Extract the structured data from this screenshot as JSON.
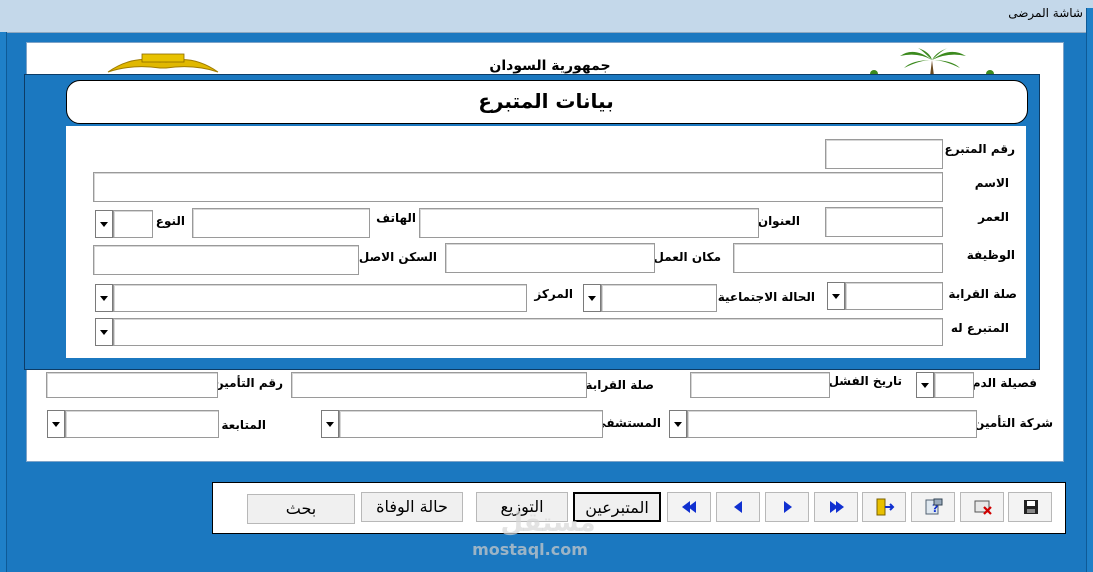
{
  "window": {
    "title": "شاشة المرضى"
  },
  "header": {
    "government": "جمهورية السودان",
    "form_title": "بيانات المتبرع"
  },
  "donor_form": {
    "donor_number_label": "رقم المتبرع",
    "name_label": "الاسم",
    "age_label": "العمر",
    "address_label": "العنوان",
    "phone_label": "الهاتف",
    "gender_label": "النوع",
    "job_label": "الوظيفة",
    "workplace_label": "مكان العمل",
    "original_residence_label": "السكن الاصل",
    "relation_label": "صلة القرابة",
    "marital_status_label": "الحالة الاجتماعية",
    "center_label": "المركز",
    "donated_to_label": "المتبرع له"
  },
  "patient_form": {
    "blood_type_label": "فصيلة الدم",
    "failure_date_label": "تاريخ الفشل",
    "relation_label": "صلة القرابة",
    "insurance_number_label": "رقم التأمين",
    "insurance_company_label": "شركة التأمين",
    "hospital_label": "المستشفى",
    "followup_label": "المتابعة"
  },
  "toolbar": {
    "donors_button": "المتبرعين",
    "distribution_button": "التوزيع",
    "death_case_button": "حالة الوفاة",
    "search_button": "بحث"
  },
  "watermark": {
    "text": "mostaql.com",
    "logo": "مستقل"
  },
  "icons": {
    "first": "first-record-icon",
    "prev": "previous-record-icon",
    "next": "next-record-icon",
    "last": "last-record-icon",
    "exit": "exit-icon",
    "help": "help-icon",
    "delete": "delete-icon",
    "save": "save-icon"
  },
  "colors": {
    "background": "#1b78c0",
    "titlebar": "#c4d8ea"
  }
}
